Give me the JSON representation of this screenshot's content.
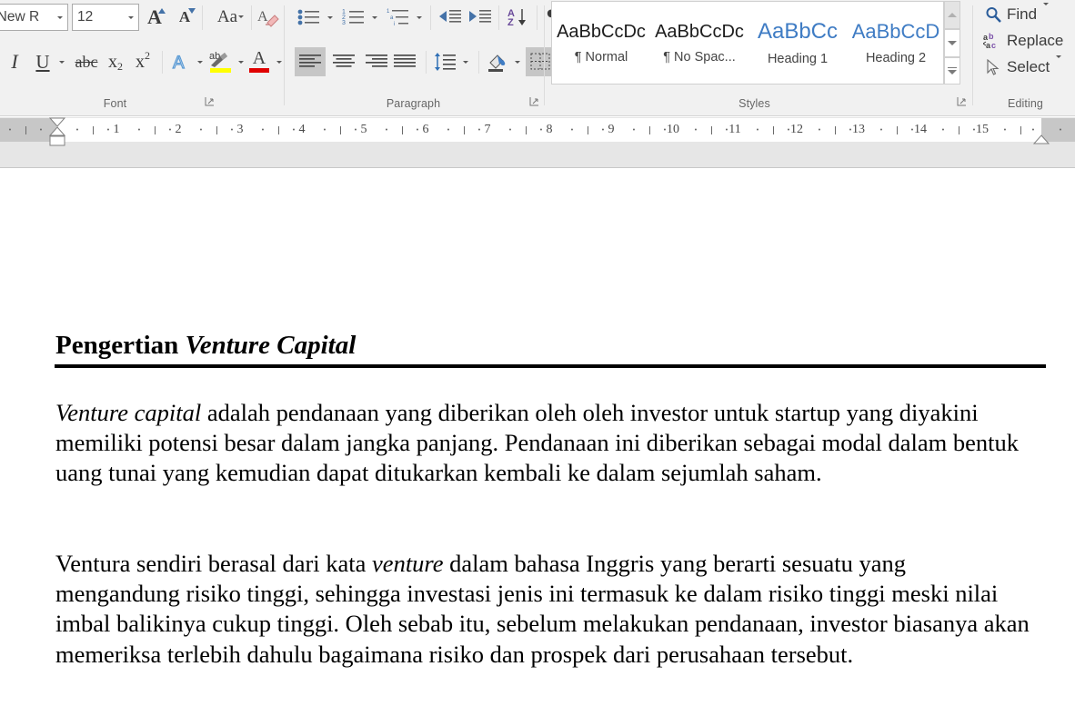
{
  "app": "word-document-editor",
  "ribbon": {
    "groups": [
      {
        "name": "font",
        "label": "Font"
      },
      {
        "name": "paragraph",
        "label": "Paragraph"
      },
      {
        "name": "styles",
        "label": "Styles"
      },
      {
        "name": "editing",
        "label": "Editing"
      }
    ],
    "font": {
      "font_name": "es New R",
      "font_name_full": "Times New Roman",
      "font_size": "12",
      "grow_font": "A",
      "shrink_font": "A",
      "change_case": "Aa",
      "clear_formatting": "clear-formatting-icon",
      "italic": "I",
      "underline": "U",
      "strikethrough": "abc",
      "subscript": "x",
      "subscript_sub": "2",
      "superscript": "x",
      "superscript_sup": "2",
      "text_effects": "A",
      "highlight": "ab",
      "highlight_color": "#ffff00",
      "font_color": "A",
      "font_color_value": "#e00000"
    },
    "paragraph": {
      "bullets": "bullets-icon",
      "numbering": "numbering-icon",
      "multilevel": "multilevel-list-icon",
      "decrease_indent": "decrease-indent-icon",
      "increase_indent": "increase-indent-icon",
      "sort": "sort-icon",
      "show_marks": "¶",
      "align_left": "align-left-icon",
      "align_center": "align-center-icon",
      "align_right": "align-right-icon",
      "justify": "justify-icon",
      "line_spacing": "line-spacing-icon",
      "shading": "shading-icon",
      "borders": "borders-icon",
      "active_alignment": "align_left"
    },
    "styles": {
      "items": [
        {
          "preview": "AaBbCcDc",
          "name": "¶ Normal",
          "kind": "normal"
        },
        {
          "preview": "AaBbCcDc",
          "name": "¶ No Spac...",
          "kind": "normal"
        },
        {
          "preview": "AaBbCc",
          "name": "Heading 1",
          "kind": "h1"
        },
        {
          "preview": "AaBbCcD",
          "name": "Heading 2",
          "kind": "h2"
        }
      ],
      "scroll_up": "scroll-up-icon",
      "scroll_down": "scroll-down-icon",
      "more": "more-styles-icon"
    },
    "editing": {
      "find": "Find",
      "replace": "Replace",
      "select": "Select"
    }
  },
  "ruler": {
    "ticks": [
      "1",
      "2",
      "3",
      "4",
      "5",
      "6",
      "7",
      "8",
      "9",
      "10",
      "11",
      "12",
      "13",
      "14",
      "15"
    ],
    "left_indent_marker": "left-indent-marker",
    "right_indent_marker": "right-indent-marker"
  },
  "document": {
    "title": {
      "bold": "Pengertian ",
      "bold_italic": "Venture Capital"
    },
    "paragraphs": [
      {
        "id": "p1",
        "runs": [
          {
            "text": "Venture capital",
            "style": "italic"
          },
          {
            "text": " adalah pendanaan yang diberikan oleh oleh investor untuk startup yang diyakini memiliki potensi besar dalam jangka panjang. Pendanaan ini diberikan sebagai modal dalam bentuk uang tunai yang kemudian dapat ditukarkan kembali ke dalam sejumlah saham.",
            "style": "normal"
          }
        ]
      },
      {
        "id": "p2",
        "runs": [
          {
            "text": "Ventura sendiri berasal dari kata ",
            "style": "normal"
          },
          {
            "text": "venture",
            "style": "italic"
          },
          {
            "text": " dalam bahasa Inggris yang berarti sesuatu yang mengandung risiko tinggi, sehingga investasi jenis ini termasuk ke dalam risiko tinggi meski nilai imbal balikinya cukup tinggi. Oleh sebab itu, sebelum melakukan pendanaan, investor biasanya akan memeriksa terlebih dahulu bagaimana risiko dan prospek dari perusahaan tersebut.",
            "style": "normal"
          }
        ]
      }
    ]
  },
  "colors": {
    "ribbon_bg": "#f1f1f1",
    "accent_blue": "#3f7cc4",
    "highlight_yellow": "#ffff00",
    "font_red": "#e00000",
    "ruler_bg": "#e6e6e6"
  }
}
